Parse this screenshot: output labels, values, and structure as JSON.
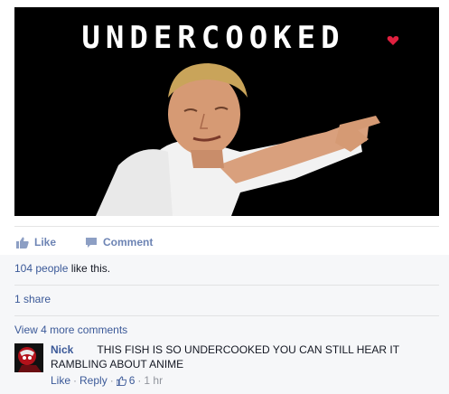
{
  "meme": {
    "title": "UNDERCOOKED"
  },
  "actions": {
    "like_label": "Like",
    "comment_label": "Comment"
  },
  "feedback": {
    "likes_count": "104 people",
    "likes_suffix": " like this.",
    "shares": "1 share",
    "more_comments": "View 4 more comments"
  },
  "comment": {
    "author": "Nick",
    "text": "THIS FISH IS SO UNDERCOOKED YOU CAN STILL HEAR IT RAMBLING ABOUT ANIME",
    "like_label": "Like",
    "separator": "·",
    "reply_label": "Reply",
    "like_count": "6",
    "time": "1 hr"
  },
  "colors": {
    "link": "#3b5998",
    "action": "#6d84b4",
    "heart": "#e0203f"
  }
}
